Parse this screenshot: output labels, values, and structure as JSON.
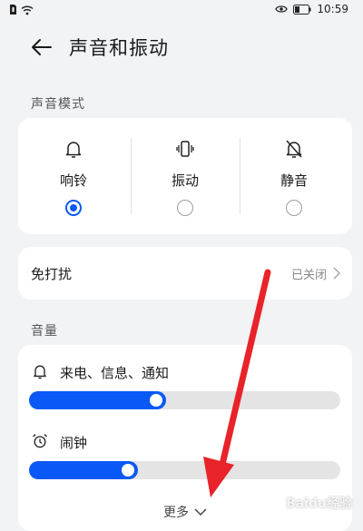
{
  "status_bar": {
    "time": "10:59"
  },
  "header": {
    "title": "声音和振动"
  },
  "sound_mode": {
    "section_label": "声音模式",
    "modes": [
      {
        "label": "响铃",
        "icon": "bell-icon",
        "selected": true
      },
      {
        "label": "振动",
        "icon": "vibrate-icon",
        "selected": false
      },
      {
        "label": "静音",
        "icon": "bell-off-icon",
        "selected": false
      }
    ]
  },
  "do_not_disturb": {
    "label": "免打扰",
    "value": "已关闭"
  },
  "volume": {
    "section_label": "音量",
    "items": [
      {
        "label": "来电、信息、通知",
        "icon": "bell-icon",
        "level": 0.44
      },
      {
        "label": "闹钟",
        "icon": "alarm-clock-icon",
        "level": 0.35
      }
    ],
    "more_label": "更多"
  },
  "colors": {
    "accent": "#0a59f7",
    "annotation_arrow": "#e8232a"
  },
  "watermark": {
    "text": "Baidu经验"
  }
}
